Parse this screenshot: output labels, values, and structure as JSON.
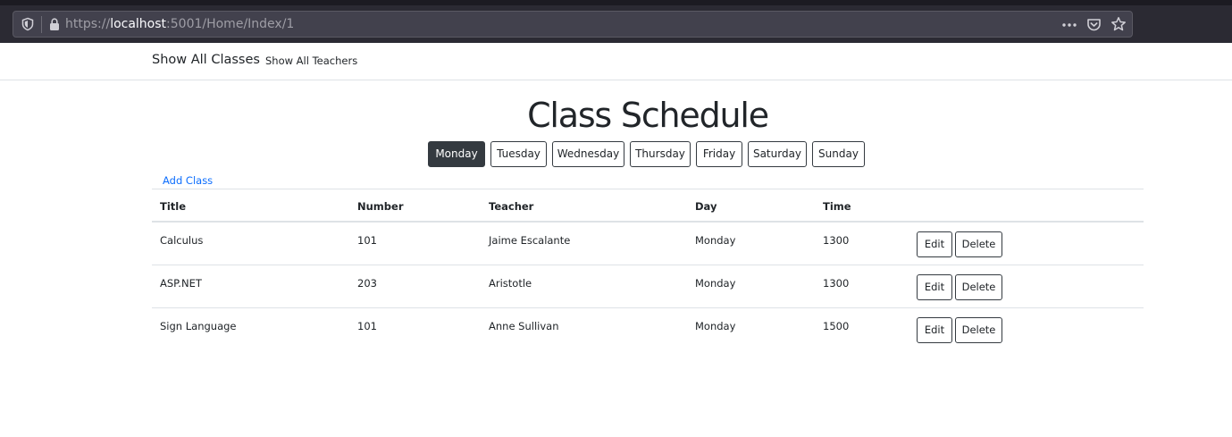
{
  "browser": {
    "url_scheme": "https://",
    "url_host": "localhost",
    "url_rest": ":5001/Home/Index/1",
    "icons": [
      "shield-icon",
      "lock-icon",
      "more-icon",
      "pocket-icon",
      "star-icon"
    ]
  },
  "nav": {
    "brand": "Show All Classes",
    "link": "Show All Teachers"
  },
  "page": {
    "title": "Class Schedule",
    "add_link": "Add Class"
  },
  "days": {
    "selected": "Monday",
    "items": [
      "Monday",
      "Tuesday",
      "Wednesday",
      "Thursday",
      "Friday",
      "Saturday",
      "Sunday"
    ]
  },
  "table": {
    "headers": {
      "title": "Title",
      "number": "Number",
      "teacher": "Teacher",
      "day": "Day",
      "time": "Time"
    },
    "rows": [
      {
        "title": "Calculus",
        "number": "101",
        "teacher": "Jaime Escalante",
        "day": "Monday",
        "time": "1300",
        "edit": "Edit",
        "delete": "Delete"
      },
      {
        "title": "ASP.NET",
        "number": "203",
        "teacher": "Aristotle",
        "day": "Monday",
        "time": "1300",
        "edit": "Edit",
        "delete": "Delete"
      },
      {
        "title": "Sign Language",
        "number": "101",
        "teacher": "Anne Sullivan",
        "day": "Monday",
        "time": "1500",
        "edit": "Edit",
        "delete": "Delete"
      }
    ]
  },
  "colors": {
    "browser_chrome": "#2b2a33",
    "url_bar": "#42414d",
    "active_button": "#343a40",
    "link": "#0d6efd",
    "border": "#dee2e6"
  }
}
